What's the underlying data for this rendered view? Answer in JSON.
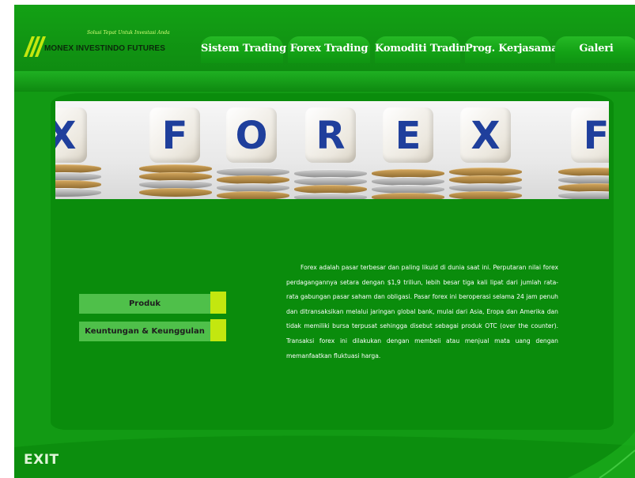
{
  "header": {
    "logo_tagline": "Solusi Tepat Untuk Investasi Anda",
    "company_name": "MONEX INVESTINDO FUTURES"
  },
  "nav": {
    "tabs": [
      {
        "label": "Sistem Trading"
      },
      {
        "label": "Forex Trading"
      },
      {
        "label": "Komoditi Trading"
      },
      {
        "label": "Prog. Kerjasama"
      },
      {
        "label": "Galeri"
      }
    ]
  },
  "banner": {
    "letters": [
      "X",
      "F",
      "O",
      "R",
      "E",
      "X",
      "F"
    ]
  },
  "side_menu": {
    "items": [
      {
        "label": "Produk"
      },
      {
        "label": "Keuntungan & Keunggulan"
      }
    ]
  },
  "main": {
    "description": "Forex adalah pasar terbesar dan paling likuid di dunia saat ini. Perputaran nilai forex perdagangannya setara dengan $1,9 triliun, lebih besar tiga kali lipat dari jumlah rata-rata gabungan pasar saham dan obligasi. Pasar forex ini beroperasi selama 24 jam penuh dan ditransaksikan melalui jaringan global bank, mulai dari Asia, Eropa dan Amerika dan tidak memiliki bursa terpusat sehingga disebut sebagai produk OTC (over the counter). Transaksi forex ini dilakukan dengan membeli atau menjual mata uang dengan memanfaatkan fluktuasi harga."
  },
  "footer": {
    "exit_label": "EXIT"
  },
  "colors": {
    "background": "#129a14",
    "panel": "#0a8c0c",
    "button": "#4fc04a",
    "button_tab": "#c3e70f",
    "die_letter": "#1f3f9c"
  }
}
